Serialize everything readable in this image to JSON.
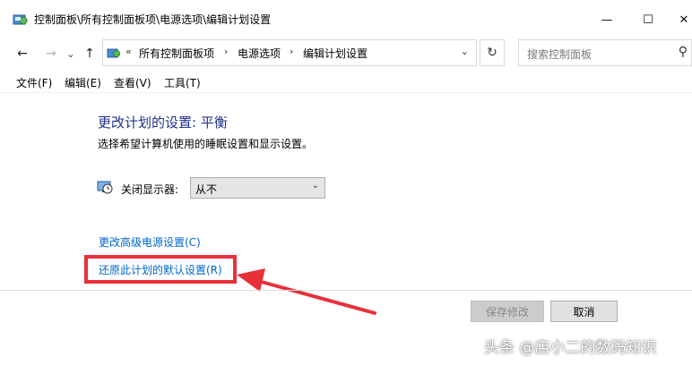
{
  "window": {
    "title": "控制面板\\所有控制面板项\\电源选项\\编辑计划设置",
    "icon": "control-panel-icon",
    "controls": {
      "minimize": "—",
      "maximize": "☐",
      "close": "✕"
    }
  },
  "nav": {
    "back": "←",
    "forward": "→",
    "recent": "⌄",
    "up": "↑"
  },
  "address": {
    "overflow": "«",
    "segments": [
      "所有控制面板项",
      "电源选项",
      "编辑计划设置"
    ],
    "separator": "›",
    "dropdown": "⌄",
    "refresh": "↻"
  },
  "search": {
    "placeholder": "搜索控制面板",
    "icon": "⚲"
  },
  "menu": [
    "文件(F)",
    "编辑(E)",
    "查看(V)",
    "工具(T)"
  ],
  "content": {
    "title": "更改计划的设置: 平衡",
    "subtitle": "选择希望计算机使用的睡眠设置和显示设置。",
    "display_label": "关闭显示器:",
    "display_value": "从不",
    "select_arrow": "⌄"
  },
  "links": {
    "advanced": "更改高级电源设置(C)",
    "restore": "还原此计划的默认设置(R)"
  },
  "buttons": {
    "save": "保存修改",
    "cancel": "取消"
  },
  "annotation_color": "#e8303a",
  "watermark": "头条 @店小二的数码知识"
}
